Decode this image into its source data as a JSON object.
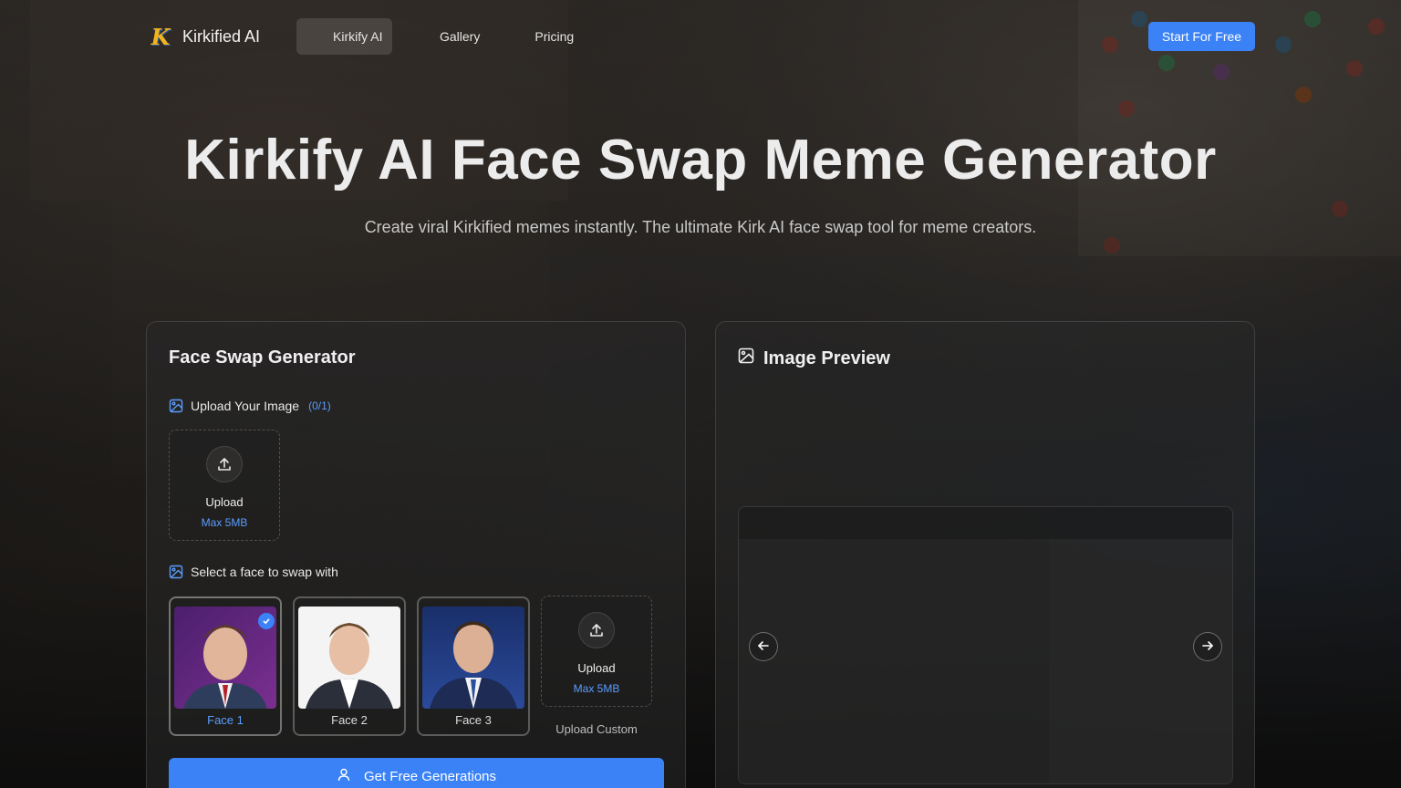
{
  "brand": {
    "name": "Kirkified AI",
    "logo_letter": "K"
  },
  "nav": {
    "items": [
      {
        "label": "Kirkify AI",
        "active": true
      },
      {
        "label": "Gallery",
        "active": false
      },
      {
        "label": "Pricing",
        "active": false
      }
    ],
    "cta_label": "Start For Free"
  },
  "hero": {
    "title": "Kirkify AI Face Swap Meme Generator",
    "subtitle": "Create viral Kirkified memes instantly. The ultimate Kirk AI face swap tool for meme creators."
  },
  "generator": {
    "title": "Face Swap Generator",
    "upload_section": {
      "label": "Upload Your Image",
      "count": "(0/1)"
    },
    "upload_box": {
      "label": "Upload",
      "max": "Max 5MB",
      "icon": "upload-icon"
    },
    "face_section": {
      "label": "Select a face to swap with"
    },
    "faces": [
      {
        "label": "Face 1",
        "selected": true
      },
      {
        "label": "Face 2",
        "selected": false
      },
      {
        "label": "Face 3",
        "selected": false
      }
    ],
    "custom_upload": {
      "label": "Upload",
      "max": "Max 5MB",
      "caption": "Upload Custom"
    },
    "generate_button": {
      "label": "Get Free Generations",
      "icon": "user-icon"
    }
  },
  "preview": {
    "title": "Image Preview",
    "icon": "image-icon",
    "prev_icon": "arrow-left-icon",
    "next_icon": "arrow-right-icon"
  },
  "colors": {
    "accent": "#3b82f6",
    "accent_text": "#5b9dff",
    "logo_gold": "#f2b31b"
  }
}
